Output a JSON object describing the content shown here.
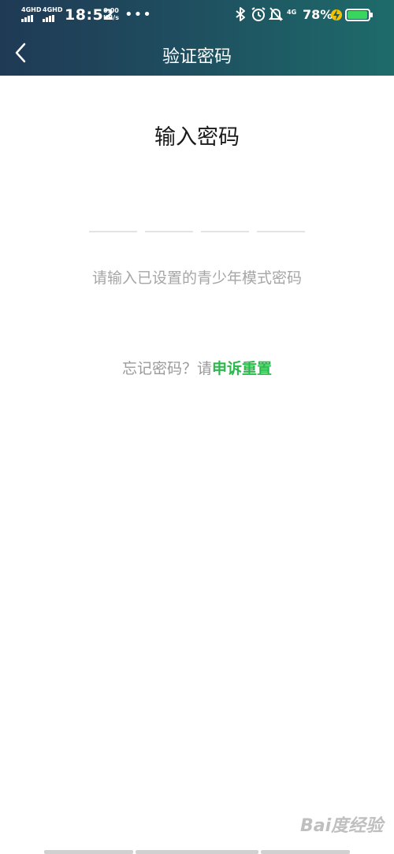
{
  "status_bar": {
    "sim1": "4GHD",
    "sim2": "4GHD",
    "time": "18:52",
    "speed_value": "0.00",
    "speed_unit": "KB/s",
    "more": "•••",
    "net": "4G",
    "battery_pct": "78%",
    "battery_level": 0.78
  },
  "header": {
    "title": "验证密码"
  },
  "main": {
    "heading": "输入密码",
    "hint": "请输入已设置的青少年模式密码",
    "forgot_prefix": "忘记密码？请",
    "forgot_link": "申诉重置"
  },
  "watermark": "Bai度经验",
  "colors": {
    "accent_link": "#2db84d",
    "header_start": "#1f3a55",
    "header_end": "#1e6b6a"
  }
}
